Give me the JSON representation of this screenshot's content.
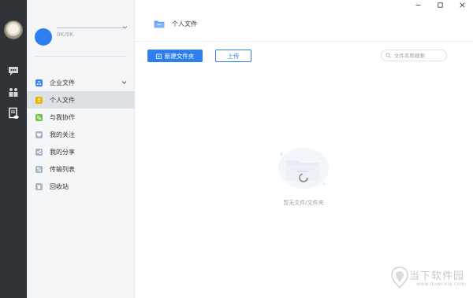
{
  "window": {
    "controls": [
      "minimize-icon",
      "maximize-icon",
      "close-icon"
    ]
  },
  "rail": {
    "icons": [
      "chat-icon",
      "contacts-icon",
      "cloud-doc-icon"
    ]
  },
  "user": {
    "quota": "0K/0K"
  },
  "nav": {
    "items": [
      {
        "label": "企业文件",
        "icon": "enterprise-icon",
        "color": "#3b86f6"
      },
      {
        "label": "个人文件",
        "icon": "personal-icon",
        "color": "#f0b400"
      },
      {
        "label": "与我协作",
        "icon": "collab-icon",
        "color": "#72c249"
      },
      {
        "label": "我的关注",
        "icon": "heart-icon",
        "color": "#a7b4c8"
      },
      {
        "label": "我的分享",
        "icon": "share-icon",
        "color": "#a7b4c8"
      },
      {
        "label": "传输列表",
        "icon": "transfer-icon",
        "color": "#a7b4c8"
      },
      {
        "label": "回收站",
        "icon": "trash-icon",
        "color": "#a7b4c8"
      }
    ],
    "active_index": 1
  },
  "main": {
    "title": "个人文件",
    "new_folder_label": "新建文件夹",
    "upload_label": "上传",
    "search_placeholder": "文件名称搜索",
    "empty_text": "暂无文件/文件夹"
  },
  "colors": {
    "accent": "#2d7ff0",
    "rail": "#2f3237",
    "side": "#f5f6f8"
  },
  "watermark": {
    "title": "当下软件园",
    "url": "www.downxia.com"
  }
}
